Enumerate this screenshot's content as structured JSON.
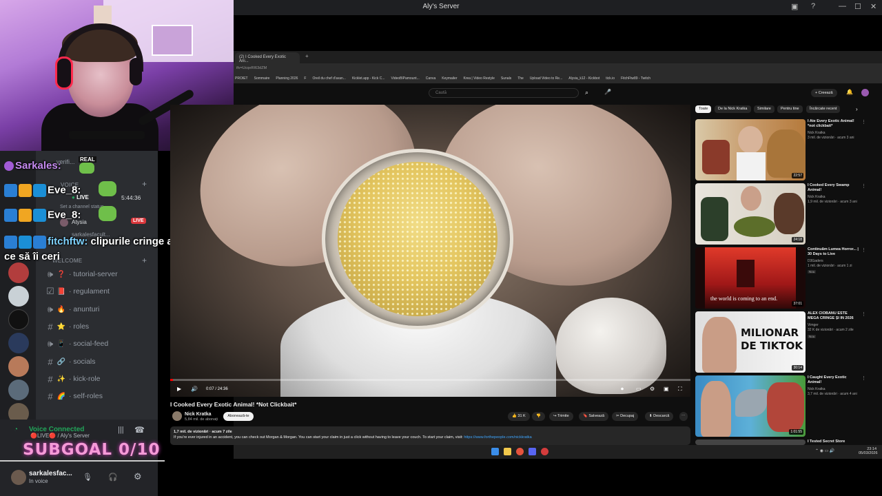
{
  "window": {
    "title": "Aly's Server"
  },
  "overlay": {
    "chat": [
      {
        "user": "Sarkales:",
        "message": ""
      },
      {
        "user": "Eve_8:",
        "message": ""
      },
      {
        "user": "Eve_8:",
        "message": ""
      },
      {
        "user": "fitchftw:",
        "message": "clipurile cringe a lui aisula ce să îi ceri"
      }
    ],
    "subgoal": "SUBGOAL 0/10"
  },
  "discord": {
    "sidebar": {
      "voice_category": "VOICE",
      "voice_status": "Set a channel status",
      "voice_users": [
        {
          "name": "Atysia",
          "live": "LIVE"
        },
        {
          "name": "sarkalesfacult...",
          "live": ""
        }
      ],
      "timer": "5:44:36",
      "real_badge": "REAL",
      "welcome_category": "WELCOME",
      "channels": [
        {
          "name": "tutorial-server",
          "type": "voice",
          "emoji": "❓"
        },
        {
          "name": "regulament",
          "type": "rules",
          "emoji": "📕"
        },
        {
          "name": "anunturi",
          "type": "voice",
          "emoji": "🔥"
        },
        {
          "name": "roles",
          "type": "text",
          "emoji": "⭐"
        },
        {
          "name": "social-feed",
          "type": "voice",
          "emoji": "📱"
        },
        {
          "name": "socials",
          "type": "text",
          "emoji": "🔗"
        },
        {
          "name": "kick-role",
          "type": "text",
          "emoji": "✨"
        },
        {
          "name": "self-roles",
          "type": "text",
          "emoji": "🌈"
        }
      ],
      "verified_channel": "verifi..."
    },
    "voice_panel": {
      "status": "Voice Connected",
      "subtitle": "🔴LIVE🔴 / Aly's Server"
    },
    "user_panel": {
      "username": "sarkalesfac...",
      "status": "In voice"
    }
  },
  "browser": {
    "tab_title": "(2) I Cooked Every Exotic Ani...",
    "url": "ifv=UcqeRI63dZM",
    "bookmarks": [
      "PROIET",
      "Sommaire",
      "Planning 2026",
      "F",
      "Oreil du chef d'avan...",
      "Kicklet.app - Kick C...",
      "VideoBlPamount...",
      "Canva",
      "Keymailer",
      "Krea | Video Restyle",
      "Sunals",
      "The",
      "Upload Video to Re...",
      "Alysia_k12 - Kickbot",
      "tick.io",
      "FitchFtw89 - Twitch"
    ]
  },
  "youtube": {
    "search_placeholder": "Caută",
    "create_label": "Creează",
    "video": {
      "title": "I Cooked Every Exotic Animal! *Not Clickbait*",
      "time": "0:07 / 24:36",
      "progress": 0.005,
      "channel": "Nick Kratka",
      "subscribers": "5,84 mil. de abonați",
      "subscribe_label": "Abonează-te",
      "likes": "31 K",
      "share_label": "Trimite",
      "save_label": "Salvează",
      "clip_label": "Decupaj",
      "download_label": "Descarcă",
      "views_line": "1,7 mil. de vizionări · acum 7 zile",
      "description": "If you're ever injured in an accident, you can check out Morgan & Morgan. You can start your claim in just a click without having to leave your couch. To start your claim, visit:",
      "description_link": "https://www.forthepeople.com/nickkratka"
    },
    "chips": [
      "Toate",
      "De la Nick Kratka",
      "Similare",
      "Pentru tine",
      "Încărcate recent"
    ],
    "recommendations": [
      {
        "title": "I Ate Every Exotic Animal! *not clickbait*",
        "channel": "Nick Kratka",
        "meta": "3 mil. de vizionări · acum 3 ani",
        "duration": "22:57",
        "badge": ""
      },
      {
        "title": "I Cooked Every Swamp Animal!",
        "channel": "Nick Kratka",
        "meta": "1,9 mil. de vizionări · acum 3 ani",
        "duration": "24:18",
        "badge": ""
      },
      {
        "title": "Continuăm Lumea Horror... | 30 Days to Live",
        "channel": "D3Gaders",
        "meta": "1 mil. de vizionări · acum 1 zi",
        "duration": "37:01",
        "badge": "Nou",
        "thumb_text": "the world is coming to an end."
      },
      {
        "title": "ALEX CIOBANU ESTE MEGA CRINGE ȘI IN 2026",
        "channel": "Vimger",
        "meta": "32 K de vizionări · acum 2 zile",
        "duration": "30:14",
        "badge": "Nou",
        "thumb_text": "MILIONAR DE TIKTOK"
      },
      {
        "title": "I Caught Every Exotic Animal!",
        "channel": "Nick Kratka",
        "meta": "3,7 mil. de vizionări · acum 4 ani",
        "duration": "1:01:55",
        "badge": ""
      },
      {
        "title": "I Tested Secret Store",
        "channel": "",
        "meta": "",
        "duration": "",
        "badge": ""
      }
    ]
  },
  "taskbar": {
    "time": "23:14",
    "date": "05/03/2026"
  },
  "colors": {
    "discord_bg": "#2b2d31",
    "youtube_bg": "#0f0f0f",
    "accent_red": "#ff0000",
    "voice_green": "#23a55a",
    "subgoal_pink": "#f59ad7"
  }
}
